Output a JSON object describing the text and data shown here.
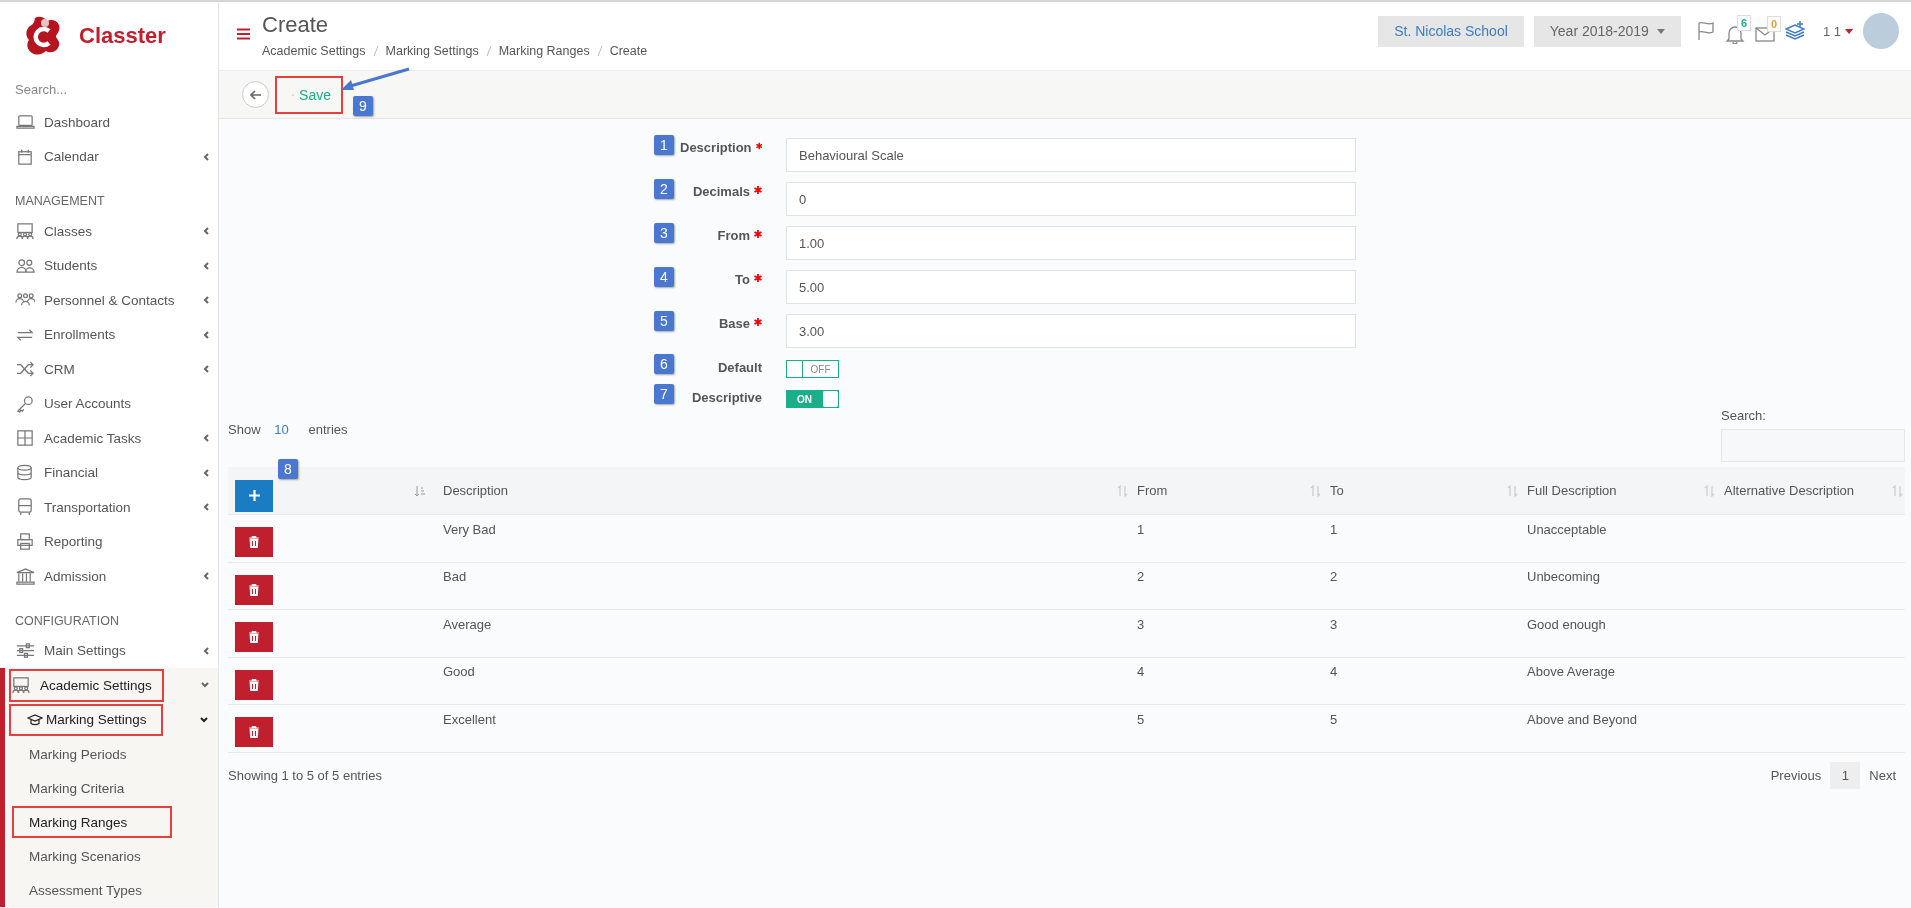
{
  "sidebar": {
    "brand": "Classter",
    "search": {
      "placeholder": "Search..."
    },
    "groups": [
      {
        "items": [
          {
            "label": "Dashboard",
            "expandable": false,
            "expanded": false,
            "selected": false,
            "highlighted": false
          },
          {
            "label": "Calendar",
            "expandable": true,
            "expanded": false,
            "selected": false,
            "highlighted": false
          }
        ]
      },
      {
        "heading": "MANAGEMENT",
        "items": [
          {
            "label": "Classes",
            "expandable": true,
            "expanded": false,
            "selected": false,
            "highlighted": false
          },
          {
            "label": "Students",
            "expandable": true,
            "expanded": false,
            "selected": false,
            "highlighted": false
          },
          {
            "label": "Personnel & Contacts",
            "expandable": true,
            "expanded": false,
            "selected": false,
            "highlighted": false
          },
          {
            "label": "Enrollments",
            "expandable": true,
            "expanded": false,
            "selected": false,
            "highlighted": false
          },
          {
            "label": "CRM",
            "expandable": true,
            "expanded": false,
            "selected": false,
            "highlighted": false
          },
          {
            "label": "User Accounts",
            "expandable": false,
            "expanded": false,
            "selected": false,
            "highlighted": false
          },
          {
            "label": "Academic Tasks",
            "expandable": true,
            "expanded": false,
            "selected": false,
            "highlighted": false
          },
          {
            "label": "Financial",
            "expandable": true,
            "expanded": false,
            "selected": false,
            "highlighted": false
          },
          {
            "label": "Transportation",
            "expandable": true,
            "expanded": false,
            "selected": false,
            "highlighted": false
          },
          {
            "label": "Reporting",
            "expandable": false,
            "expanded": false,
            "selected": false,
            "highlighted": false
          },
          {
            "label": "Admission",
            "expandable": true,
            "expanded": false,
            "selected": false,
            "highlighted": false
          }
        ]
      },
      {
        "heading": "CONFIGURATION",
        "items": [
          {
            "label": "Main Settings",
            "expandable": true,
            "expanded": false,
            "selected": false,
            "highlighted": false
          },
          {
            "label": "Academic Settings",
            "expandable": true,
            "expanded": true,
            "selected": true,
            "highlighted": true,
            "children": [
              {
                "label": "Marking Settings",
                "expandable": true,
                "expanded": true,
                "selected": true,
                "highlighted": true,
                "children": [
                  {
                    "label": "Marking Periods",
                    "selected": false,
                    "highlighted": false
                  },
                  {
                    "label": "Marking Criteria",
                    "selected": false,
                    "highlighted": false
                  },
                  {
                    "label": "Marking Ranges",
                    "selected": true,
                    "highlighted": true
                  },
                  {
                    "label": "Marking Scenarios",
                    "selected": false,
                    "highlighted": false
                  },
                  {
                    "label": "Assessment Types",
                    "selected": false,
                    "highlighted": false
                  }
                ]
              }
            ]
          }
        ]
      }
    ]
  },
  "header": {
    "title": "Create",
    "breadcrumb": [
      "Academic Settings",
      "Marking Settings",
      "Marking Ranges",
      "Create"
    ],
    "school": "St. Nicolas School",
    "year": "Year 2018-2019",
    "notifications": "6",
    "messages": "0",
    "user": "1 1"
  },
  "toolbar": {
    "save": {
      "label": "Save",
      "highlighted": true
    },
    "callout": "9"
  },
  "form": {
    "fields": [
      {
        "kind": "text",
        "label": "Description",
        "required": true,
        "value": "Behavioural Scale",
        "callout": "1"
      },
      {
        "kind": "text",
        "label": "Decimals",
        "required": true,
        "value": "0",
        "callout": "2"
      },
      {
        "kind": "text",
        "label": "From",
        "required": true,
        "value": "1.00",
        "callout": "3"
      },
      {
        "kind": "text",
        "label": "To",
        "required": true,
        "value": "5.00",
        "callout": "4"
      },
      {
        "kind": "text",
        "label": "Base",
        "required": true,
        "value": "3.00",
        "callout": "5"
      },
      {
        "kind": "toggle",
        "label": "Default",
        "on": false,
        "state_text": "OFF",
        "callout": "6"
      },
      {
        "kind": "toggle",
        "label": "Descriptive",
        "on": true,
        "state_text": "ON",
        "callout": "7"
      }
    ]
  },
  "table": {
    "show_label": "Show",
    "page_length": "10",
    "entries_label": "entries",
    "search_label": "Search:",
    "add_callout": "8",
    "columns": [
      "Description",
      "From",
      "To",
      "Full Description",
      "Alternative Description"
    ],
    "rows": [
      {
        "description": "Very Bad",
        "from": "1",
        "to": "1",
        "full_description": "Unacceptable"
      },
      {
        "description": "Bad",
        "from": "2",
        "to": "2",
        "full_description": "Unbecoming"
      },
      {
        "description": "Average",
        "from": "3",
        "to": "3",
        "full_description": "Good enough"
      },
      {
        "description": "Good",
        "from": "4",
        "to": "4",
        "full_description": "Above Average"
      },
      {
        "description": "Excellent",
        "from": "5",
        "to": "5",
        "full_description": "Above and Beyond"
      }
    ],
    "info": "Showing 1 to 5 of 5 entries",
    "pagination": {
      "previous": "Previous",
      "pages": [
        {
          "label": "1",
          "selected": true
        }
      ],
      "next": "Next"
    }
  }
}
